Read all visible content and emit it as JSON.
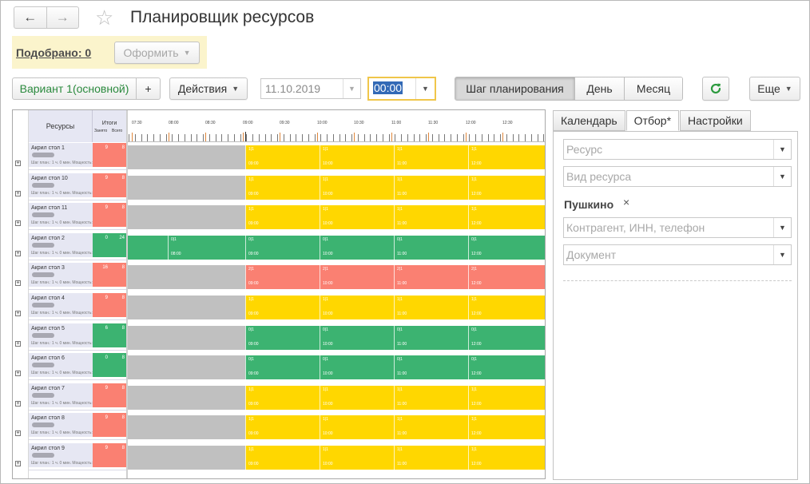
{
  "window": {
    "title": "Планировщик ресурсов",
    "back_icon": "←",
    "forward_icon": "→",
    "star_icon": "☆"
  },
  "selected": {
    "link": "Подобрано: 0",
    "make_button": "Оформить"
  },
  "toolbar": {
    "variant": "Вариант 1(основной)",
    "add": "+",
    "actions": "Действия",
    "date": "11.10.2019",
    "time": "00:00",
    "modes": [
      "Шаг планирования",
      "День",
      "Месяц"
    ],
    "active_mode": "Шаг планирования",
    "more": "Еще"
  },
  "colors": {
    "yellow": "#ffd700",
    "gray": "#c0c0c0",
    "green": "#3cb371",
    "red": "#fa8072",
    "accent": "#2b8a3e"
  },
  "planner": {
    "resources_header": "Ресурсы",
    "totals_header": "Итоги",
    "busy_header": "Занято",
    "all_header": "Всего",
    "hours": [
      "07:30",
      "08:00",
      "08:30",
      "09:00",
      "09:30",
      "10:00",
      "10:30",
      "11:00",
      "11:30",
      "12:00",
      "12:30"
    ],
    "rows": [
      {
        "name": "Акрил стол 1",
        "desc": "Шаг план.: 1 ч. 0 мин. Мощность:1",
        "busy": "9",
        "total": "8",
        "color": "red",
        "cells": [
          {
            "t": "1|1",
            "h": "09:00"
          },
          {
            "t": "1|1",
            "h": "10:00"
          },
          {
            "t": "1|1",
            "h": "11:00"
          },
          {
            "t": "1|1",
            "h": "12:00"
          }
        ],
        "kind": "yellow"
      },
      {
        "name": "Акрил стол 10",
        "desc": "Шаг план.: 1 ч. 0 мин. Мощность:1",
        "busy": "9",
        "total": "8",
        "color": "red",
        "cells": [
          {
            "t": "1|1",
            "h": "09:00"
          },
          {
            "t": "1|1",
            "h": "10:00"
          },
          {
            "t": "1|1",
            "h": "11:00"
          },
          {
            "t": "1|1",
            "h": "12:00"
          }
        ],
        "kind": "yellow"
      },
      {
        "name": "Акрил стол 11",
        "desc": "Шаг план.: 1 ч. 0 мин. Мощность:1",
        "busy": "9",
        "total": "8",
        "color": "red",
        "cells": [
          {
            "t": "1|1",
            "h": "09:00"
          },
          {
            "t": "1|1",
            "h": "10:00"
          },
          {
            "t": "1|1",
            "h": "11:00"
          },
          {
            "t": "1|1",
            "h": "12:00"
          }
        ],
        "kind": "yellow"
      },
      {
        "name": "Акрил стол 2",
        "desc": "Шаг план.: 1 ч. 0 мин. Мощность:1",
        "busy": "0",
        "total": "24",
        "color": "green",
        "cells": [
          {
            "t": "0|1",
            "h": "08:00"
          },
          {
            "t": "0|1",
            "h": "09:00"
          },
          {
            "t": "0|1",
            "h": "10:00"
          },
          {
            "t": "0|1",
            "h": "11:00"
          },
          {
            "t": "0|1",
            "h": "12:00"
          }
        ],
        "kind": "green-full"
      },
      {
        "name": "Акрил стол 3",
        "desc": "Шаг план.: 1 ч. 0 мин. Мощность:1",
        "busy": "16",
        "total": "8",
        "color": "red",
        "cells": [
          {
            "t": "2|1",
            "h": "09:00"
          },
          {
            "t": "2|1",
            "h": "10:00"
          },
          {
            "t": "2|1",
            "h": "11:00"
          },
          {
            "t": "2|1",
            "h": "12:00"
          }
        ],
        "kind": "red"
      },
      {
        "name": "Акрил стол 4",
        "desc": "Шаг план.: 1 ч. 0 мин. Мощность:1",
        "busy": "9",
        "total": "8",
        "color": "red",
        "cells": [
          {
            "t": "1|1",
            "h": "09:00"
          },
          {
            "t": "1|1",
            "h": "10:00"
          },
          {
            "t": "1|1",
            "h": "11:00"
          },
          {
            "t": "1|1",
            "h": "12:00"
          }
        ],
        "kind": "yellow"
      },
      {
        "name": "Акрил стол 5",
        "desc": "Шаг план.: 1 ч. 0 мин. Мощность:1",
        "busy": "6",
        "total": "8",
        "color": "green",
        "cells": [
          {
            "t": "0|1",
            "h": "09:00"
          },
          {
            "t": "0|1",
            "h": "10:00"
          },
          {
            "t": "0|1",
            "h": "11:00"
          },
          {
            "t": "0|1",
            "h": "12:00"
          }
        ],
        "kind": "green"
      },
      {
        "name": "Акрил стол 6",
        "desc": "Шаг план.: 1 ч. 0 мин. Мощность:1",
        "busy": "0",
        "total": "8",
        "color": "green",
        "cells": [
          {
            "t": "0|1",
            "h": "09:00"
          },
          {
            "t": "0|1",
            "h": "10:00"
          },
          {
            "t": "0|1",
            "h": "11:00"
          },
          {
            "t": "0|1",
            "h": "12:00"
          }
        ],
        "kind": "green"
      },
      {
        "name": "Акрил стол 7",
        "desc": "Шаг план.: 1 ч. 0 мин. Мощность:1",
        "busy": "9",
        "total": "8",
        "color": "red",
        "cells": [
          {
            "t": "1|1",
            "h": "09:00"
          },
          {
            "t": "1|1",
            "h": "10:00"
          },
          {
            "t": "1|1",
            "h": "11:00"
          },
          {
            "t": "1|1",
            "h": "12:00"
          }
        ],
        "kind": "yellow"
      },
      {
        "name": "Акрил стол 8",
        "desc": "Шаг план.: 1 ч. 0 мин. Мощность:1",
        "busy": "9",
        "total": "8",
        "color": "red",
        "cells": [
          {
            "t": "1|1",
            "h": "09:00"
          },
          {
            "t": "1|1",
            "h": "10:00"
          },
          {
            "t": "1|1",
            "h": "11:00"
          },
          {
            "t": "1|1",
            "h": "12:00"
          }
        ],
        "kind": "yellow"
      },
      {
        "name": "Акрил стол 9",
        "desc": "Шаг план.: 1 ч. 0 мин. Мощность:1",
        "busy": "9",
        "total": "8",
        "color": "red",
        "cells": [
          {
            "t": "1|1",
            "h": "09:00"
          },
          {
            "t": "1|1",
            "h": "10:00"
          },
          {
            "t": "1|1",
            "h": "11:00"
          },
          {
            "t": "1|1",
            "h": "12:00"
          }
        ],
        "kind": "yellow"
      }
    ]
  },
  "panel": {
    "tabs": [
      "Календарь",
      "Отбор*",
      "Настройки"
    ],
    "active_tab": "Отбор*",
    "resource_placeholder": "Ресурс",
    "resource_type_placeholder": "Вид ресурса",
    "filter_label": "Пушкино",
    "filter_close": "×",
    "counterparty_placeholder": "Контрагент, ИНН, телефон",
    "document_placeholder": "Документ"
  }
}
